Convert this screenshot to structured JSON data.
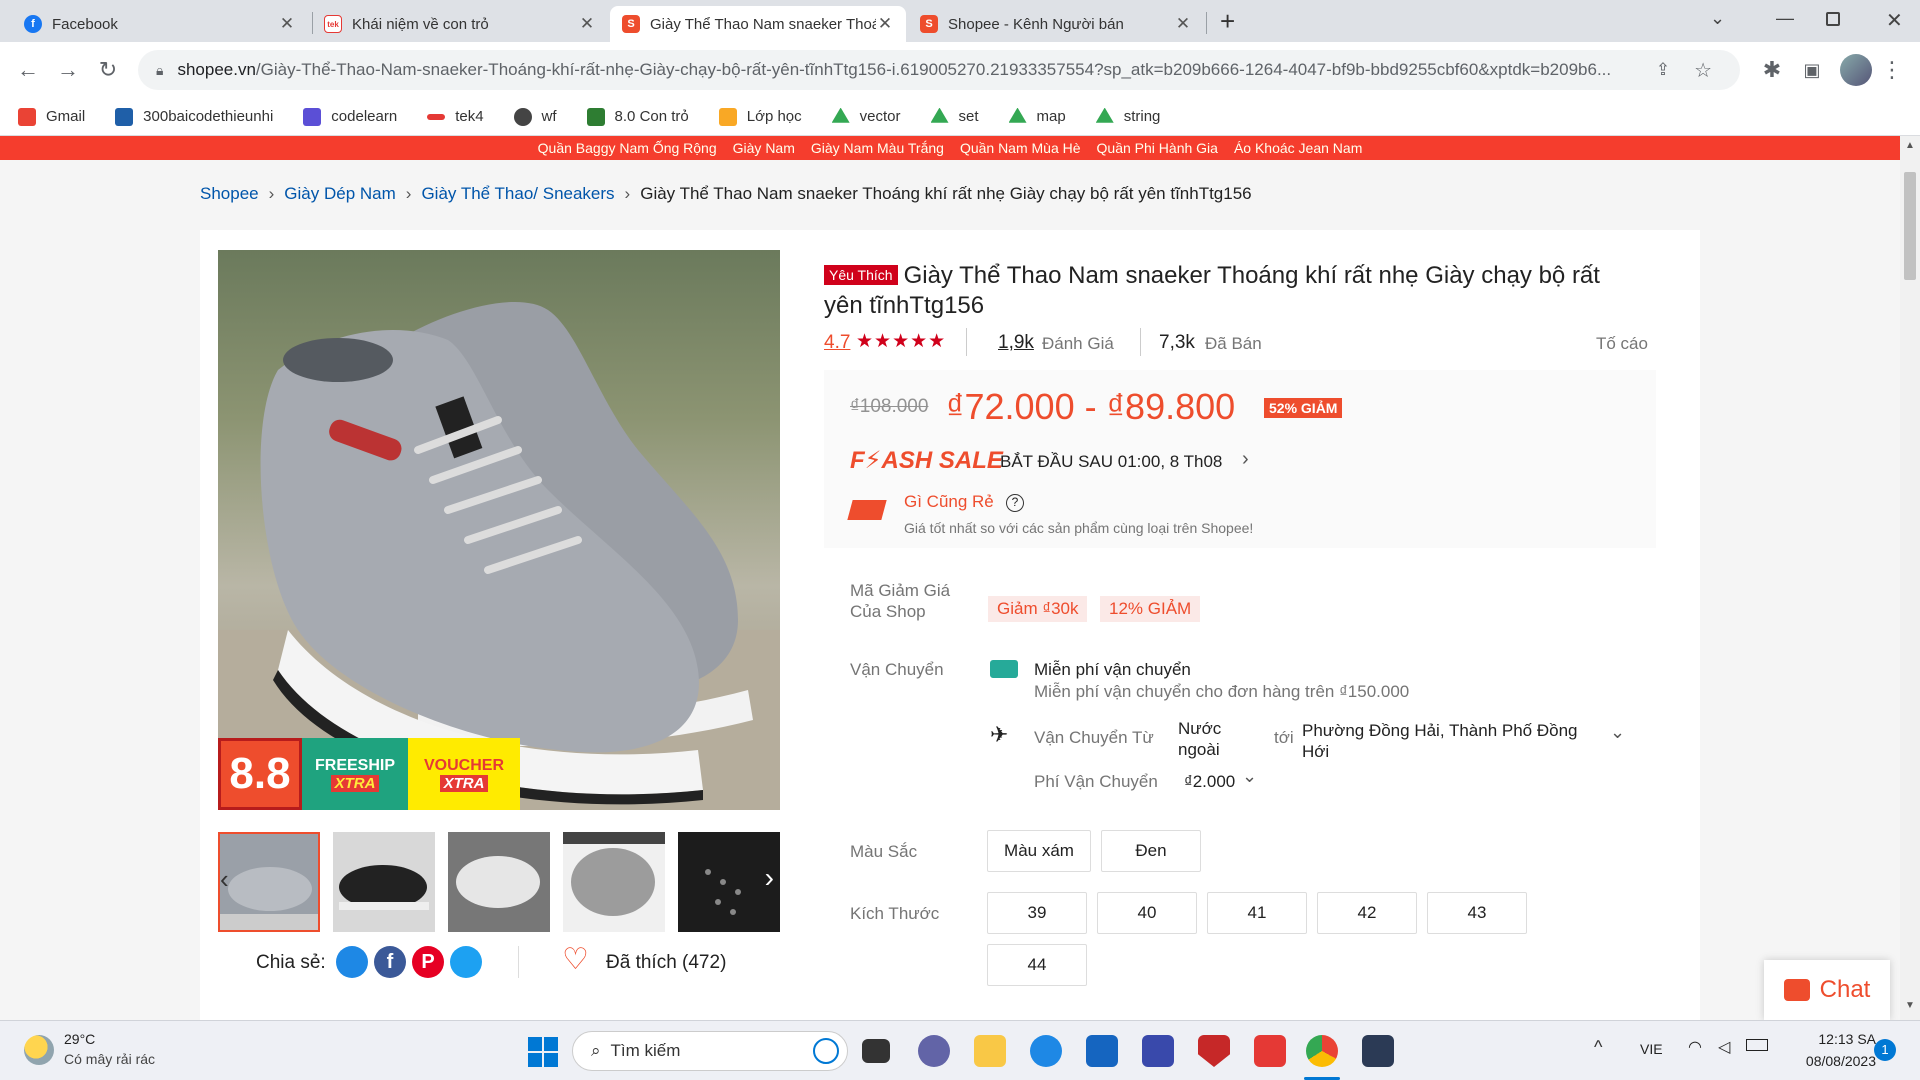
{
  "browser": {
    "tabs": [
      {
        "title": "Facebook",
        "favicon": "facebook-icon",
        "active": false
      },
      {
        "title": "Khái niệm về con trỏ",
        "favicon": "tek4-icon",
        "active": false
      },
      {
        "title": "Giày Thể Thao Nam snaeker Thoá",
        "favicon": "shopee-icon",
        "active": true
      },
      {
        "title": "Shopee - Kênh Người bán",
        "favicon": "shopee-icon",
        "active": false
      }
    ],
    "url_host": "shopee.vn",
    "url_path": "/Giày-Thể-Thao-Nam-snaeker-Thoáng-khí-rất-nhẹ-Giày-chạy-bộ-rất-yên-tĩnhTtg156-i.619005270.21933357554?sp_atk=b209b666-1264-4047-bf9b-bbd9255cbf60&xptdk=b209b6...",
    "bookmarks": [
      {
        "label": "Gmail",
        "color": "#ea4335"
      },
      {
        "label": "300baicodethieunhi",
        "color": "#1f5fa8"
      },
      {
        "label": "codelearn",
        "color": "#5b4fd6"
      },
      {
        "label": "tek4",
        "color": "#e53935"
      },
      {
        "label": "wf",
        "color": "#444444"
      },
      {
        "label": "8.0 Con trỏ",
        "color": "#2e7d32"
      },
      {
        "label": "Lớp học",
        "color": "#f9a825"
      },
      {
        "label": "vector",
        "color": "#34a853"
      },
      {
        "label": "set",
        "color": "#34a853"
      },
      {
        "label": "map",
        "color": "#34a853"
      },
      {
        "label": "string",
        "color": "#34a853"
      }
    ]
  },
  "page": {
    "top_links": [
      "Quần Baggy Nam Ống Rộng",
      "Giày Nam",
      "Giày Nam Màu Trắng",
      "Quần Nam Mùa Hè",
      "Quần Phi Hành Gia",
      "Áo Khoác Jean Nam"
    ],
    "breadcrumb": [
      "Shopee",
      "Giày Dép Nam",
      "Giày Thể Thao/ Sneakers",
      "Giày Thể Thao Nam snaeker Thoáng khí rất nhẹ Giày chạy bộ rất yên tĩnhTtg156"
    ],
    "badge": "Yêu Thích",
    "title": "Giày Thể Thao Nam snaeker Thoáng khí rất nhẹ Giày chạy bộ rất yên tĩnhTtg156",
    "rating": "4.7",
    "rating_count": "1,9k",
    "rating_label": "Đánh Giá",
    "sold_count": "7,3k",
    "sold_label": "Đã Bán",
    "report": "Tố cáo",
    "old_price": "₫108.000",
    "price_range": "₫72.000 - ₫89.800",
    "discount": "52% GIẢM",
    "flash_sale": "F⚡ASH SALE",
    "flash_sale_time": "BẮT ĐẦU SAU 01:00, 8 Th08",
    "cheap_title": "Gì Cũng Rẻ",
    "cheap_desc": "Giá tốt nhất so với các sản phẩm cùng loại trên Shopee!",
    "voucher_label": "Mã Giảm Giá Của Shop",
    "vouchers": [
      "Giảm ₫30k",
      "12% GIẢM"
    ],
    "shipping_label": "Vận Chuyển",
    "free_ship": "Miễn phí vận chuyển",
    "free_ship_desc": "Miễn phí vận chuyển cho đơn hàng trên ₫150.000",
    "ship_from_label": "Vận Chuyển Từ",
    "ship_from": "Nước ngoài",
    "ship_to_word": "tới",
    "ship_to": "Phường Đồng Hải, Thành Phố Đồng Hới",
    "ship_fee_label": "Phí Vận Chuyển",
    "ship_fee": "₫2.000",
    "color_label": "Màu Sắc",
    "colors": [
      "Màu xám",
      "Đen"
    ],
    "size_label": "Kích Thước",
    "sizes": [
      "39",
      "40",
      "41",
      "42",
      "43",
      "44"
    ],
    "share_label": "Chia sẻ:",
    "liked": "Đã thích (472)",
    "chat": "Chat",
    "banner": {
      "big": "8.8",
      "freeship": "FREESHIP",
      "freeship_sub": "XTRA",
      "voucher": "VOUCHER",
      "voucher_sub": "XTRA"
    }
  },
  "taskbar": {
    "weather_temp": "29°C",
    "weather_desc": "Có mây rải rác",
    "search": "Tìm kiếm",
    "lang": "VIE",
    "time": "12:13 SA",
    "date": "08/08/2023",
    "notif_count": "1"
  }
}
